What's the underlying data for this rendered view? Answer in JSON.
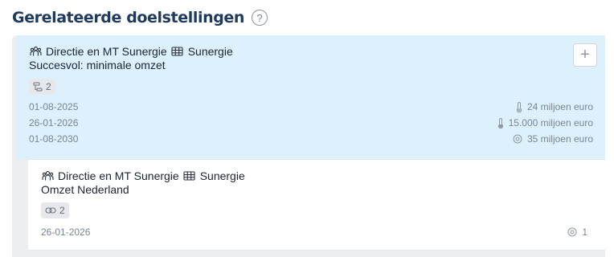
{
  "header": {
    "title": "Gerelateerde doelstellingen",
    "help_glyph": "?"
  },
  "goals": [
    {
      "owner": "Directie en MT Sunergie",
      "organization": "Sunergie",
      "title": "Succesvol: minimale omzet",
      "relation_count": "2",
      "dates": [
        "01-08-2025",
        "26-01-2026",
        "01-08-2030"
      ],
      "metrics": [
        {
          "icon": "thermometer-icon",
          "value": "24 miljoen euro"
        },
        {
          "icon": "thermometer-icon",
          "value": "15.000 miljoen euro"
        },
        {
          "icon": "target-icon",
          "value": "35 miljoen euro"
        }
      ],
      "add_label": "+"
    },
    {
      "owner": "Directie en MT Sunergie",
      "organization": "Sunergie",
      "title": "Omzet Nederland",
      "relation_count": "2",
      "date": "26-01-2026",
      "target_count": "1"
    }
  ],
  "colors": {
    "title": "#1f3a5f",
    "parent_card_bg": "#ddf1fc",
    "panel_bg": "#eceef1"
  }
}
